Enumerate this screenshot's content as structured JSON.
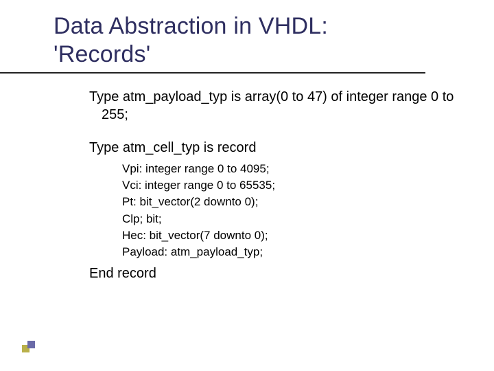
{
  "title": "Data Abstraction in VHDL: 'Records'",
  "payload_def": "Type atm_payload_typ is array(0 to 47) of integer range 0 to 255;",
  "record_open": "Type atm_cell_typ is record",
  "fields": [
    "Vpi: integer range 0 to 4095;",
    "Vci: integer range 0 to 65535;",
    "Pt: bit_vector(2 downto 0);",
    "Clp; bit;",
    "Hec: bit_vector(7 downto 0);",
    "Payload: atm_payload_typ;"
  ],
  "record_close": "End record"
}
